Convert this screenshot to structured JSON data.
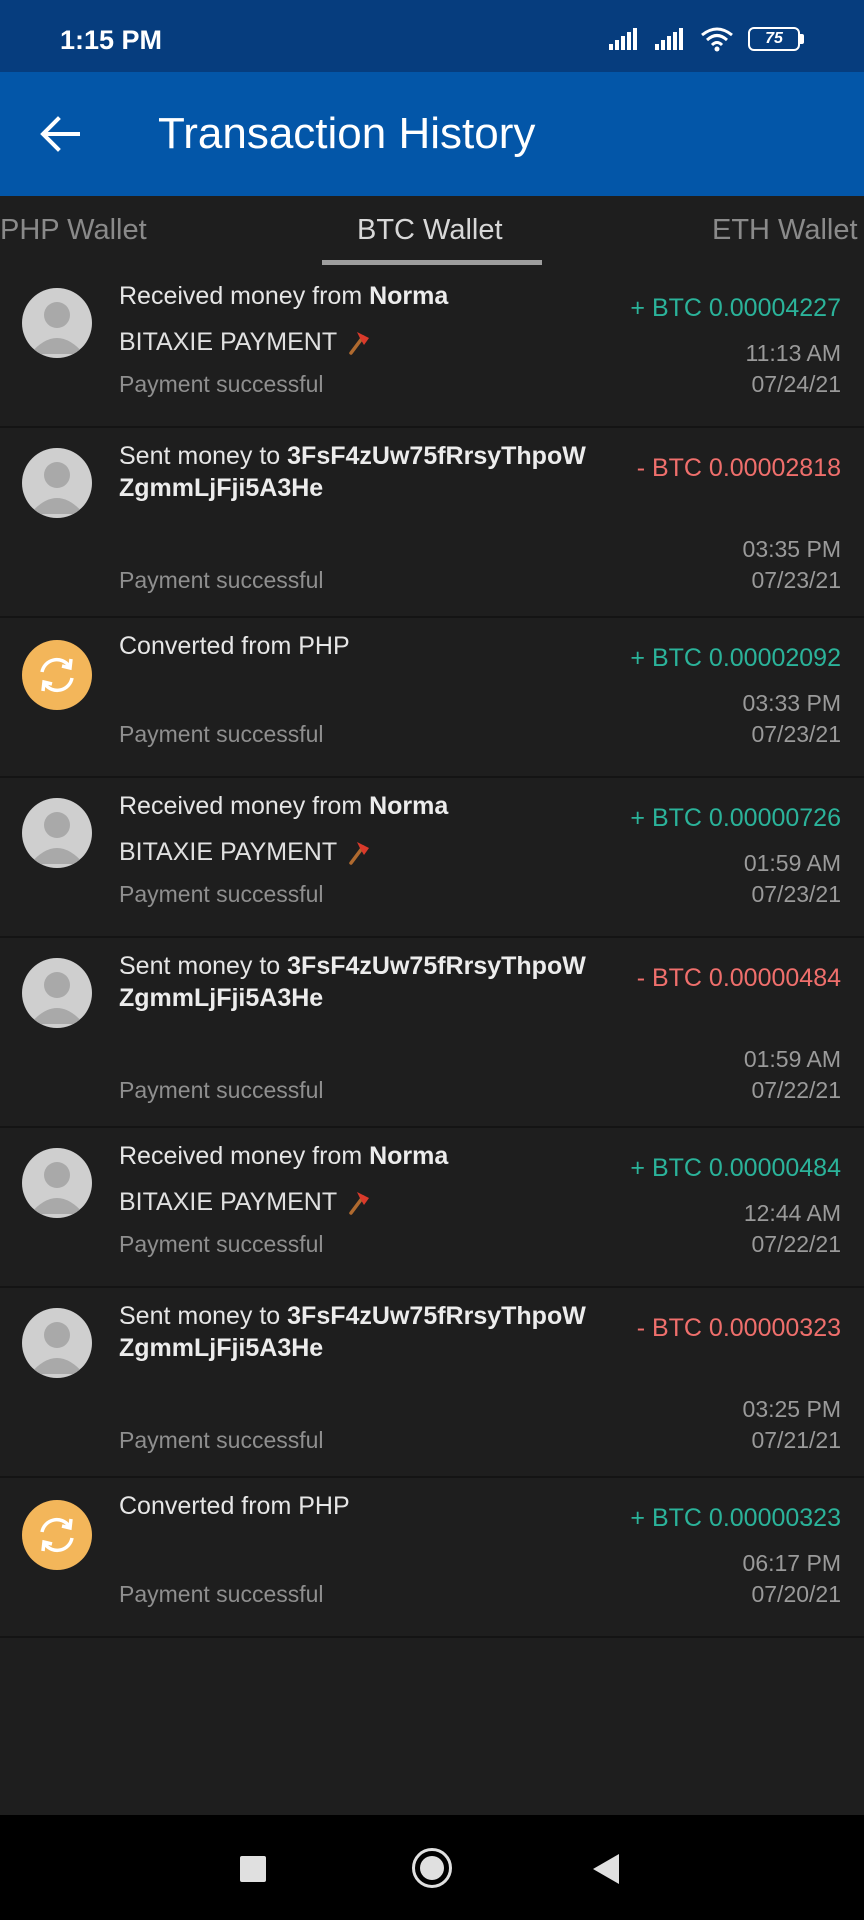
{
  "status_bar": {
    "time": "1:15 PM",
    "battery": "75"
  },
  "app_bar": {
    "title": "Transaction History"
  },
  "tabs": [
    {
      "label": "PHP Wallet"
    },
    {
      "label": "BTC Wallet",
      "active": true
    },
    {
      "label": "ETH Wallet"
    }
  ],
  "transactions": [
    {
      "kind": "received",
      "title_prefix": "Received money from ",
      "counterparty": "Norma",
      "counterparty_cont": "",
      "memo": "BITAXIE PAYMENT",
      "amount": "+ BTC 0.00004227",
      "direction": "in",
      "time": "11:13 AM",
      "date": "07/24/21",
      "status": "Payment successful"
    },
    {
      "kind": "sent",
      "title_prefix": "Sent money to ",
      "counterparty": "3FsF4zUw75fRrsyThpoW",
      "counterparty_cont": "ZgmmLjFji5A3He",
      "memo": "",
      "amount": "- BTC 0.00002818",
      "direction": "out",
      "time": "03:35 PM",
      "date": "07/23/21",
      "status": "Payment successful"
    },
    {
      "kind": "converted",
      "title_prefix": "Converted from PHP",
      "counterparty": "",
      "counterparty_cont": "",
      "memo": "",
      "amount": "+ BTC 0.00002092",
      "direction": "in",
      "time": "03:33 PM",
      "date": "07/23/21",
      "status": "Payment successful"
    },
    {
      "kind": "received",
      "title_prefix": "Received money from ",
      "counterparty": "Norma",
      "counterparty_cont": "",
      "memo": "BITAXIE PAYMENT",
      "amount": "+ BTC 0.00000726",
      "direction": "in",
      "time": "01:59 AM",
      "date": "07/23/21",
      "status": "Payment successful"
    },
    {
      "kind": "sent",
      "title_prefix": "Sent money to ",
      "counterparty": "3FsF4zUw75fRrsyThpoW",
      "counterparty_cont": "ZgmmLjFji5A3He",
      "memo": "",
      "amount": "- BTC 0.00000484",
      "direction": "out",
      "time": "01:59 AM",
      "date": "07/22/21",
      "status": "Payment successful"
    },
    {
      "kind": "received",
      "title_prefix": "Received money from ",
      "counterparty": "Norma",
      "counterparty_cont": "",
      "memo": "BITAXIE PAYMENT",
      "amount": "+ BTC 0.00000484",
      "direction": "in",
      "time": "12:44 AM",
      "date": "07/22/21",
      "status": "Payment successful"
    },
    {
      "kind": "sent",
      "title_prefix": "Sent money to ",
      "counterparty": "3FsF4zUw75fRrsyThpoW",
      "counterparty_cont": "ZgmmLjFji5A3He",
      "memo": "",
      "amount": "- BTC 0.00000323",
      "direction": "out",
      "time": "03:25 PM",
      "date": "07/21/21",
      "status": "Payment successful"
    },
    {
      "kind": "converted",
      "title_prefix": "Converted from PHP",
      "counterparty": "",
      "counterparty_cont": "",
      "memo": "",
      "amount": "+ BTC 0.00000323",
      "direction": "in",
      "time": "06:17 PM",
      "date": "07/20/21",
      "status": "Payment successful"
    }
  ],
  "icons": {
    "back": "arrow-left-icon",
    "avatar": "person-avatar-icon",
    "convert": "convert-arrows-icon",
    "memo_emoji": "axe-icon"
  },
  "colors": {
    "header_blue": "#0356a8",
    "status_bar_blue": "#063d7e",
    "incoming": "#2bb39a",
    "outgoing": "#ef6f6c",
    "convert_badge": "#f3b65a"
  }
}
